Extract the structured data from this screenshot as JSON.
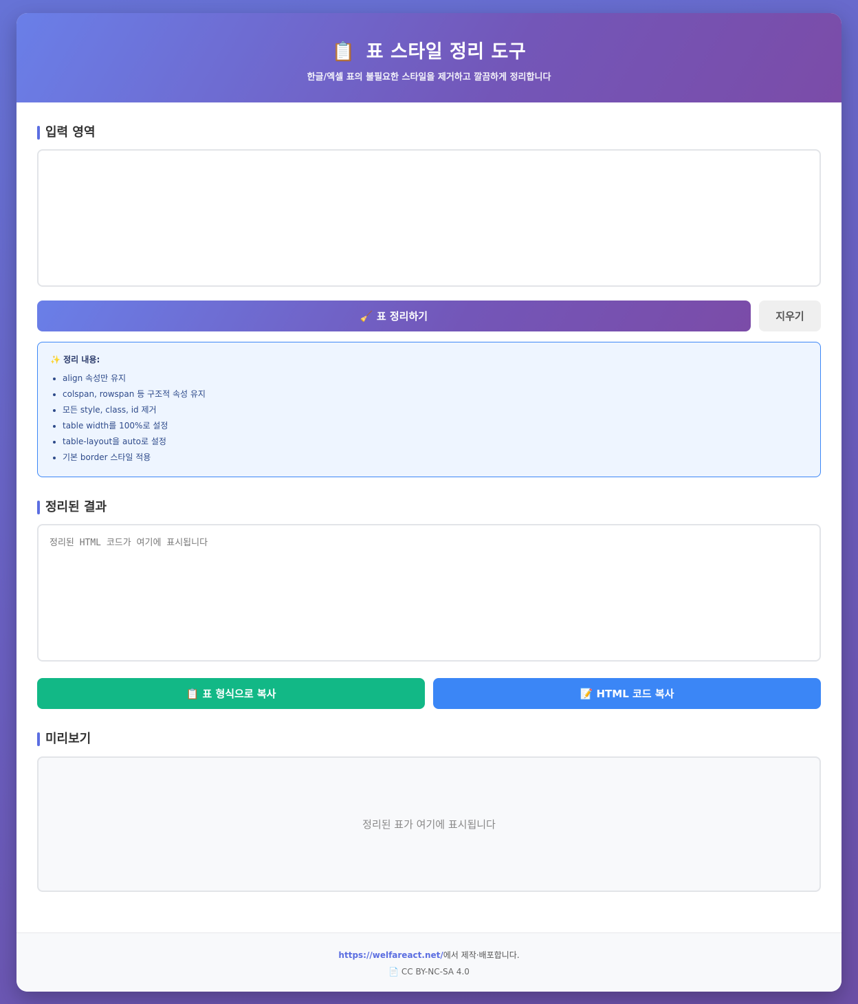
{
  "header": {
    "icon": "📋",
    "title": "표 스타일 정리 도구",
    "subtitle": "한글/엑셀 표의 불필요한 스타일을 제거하고 깔끔하게 정리합니다"
  },
  "input_section": {
    "title": "입력 영역",
    "value": ""
  },
  "actions": {
    "clean_icon": "🧹",
    "clean_label": "표 정리하기",
    "clear_label": "지우기"
  },
  "info": {
    "icon": "✨",
    "title": "정리 내용:",
    "items": [
      "align 속성만 유지",
      "colspan, rowspan 등 구조적 속성 유지",
      "모든 style, class, id 제거",
      "table width를 100%로 설정",
      "table-layout을 auto로 설정",
      "기본 border 스타일 적용"
    ]
  },
  "result_section": {
    "title": "정리된 결과",
    "placeholder": "정리된 HTML 코드가 여기에 표시됩니다"
  },
  "copy": {
    "table_icon": "📋",
    "table_label": "표 형식으로 복사",
    "html_icon": "📝",
    "html_label": "HTML 코드 복사"
  },
  "preview_section": {
    "title": "미리보기",
    "empty_text": "정리된 표가 여기에 표시됩니다"
  },
  "footer": {
    "link_text": "https://welfareact.net/",
    "suffix": "에서 제작·배포합니다.",
    "license_icon": "📄",
    "license": "CC BY-NC-SA 4.0"
  },
  "colors": {
    "primary_gradient_start": "#6a7fe8",
    "primary_gradient_end": "#7b4ca8",
    "accent_bar": "#5b6ee1",
    "copy_table_button": "#12b886",
    "copy_html_button": "#3b86f6"
  }
}
